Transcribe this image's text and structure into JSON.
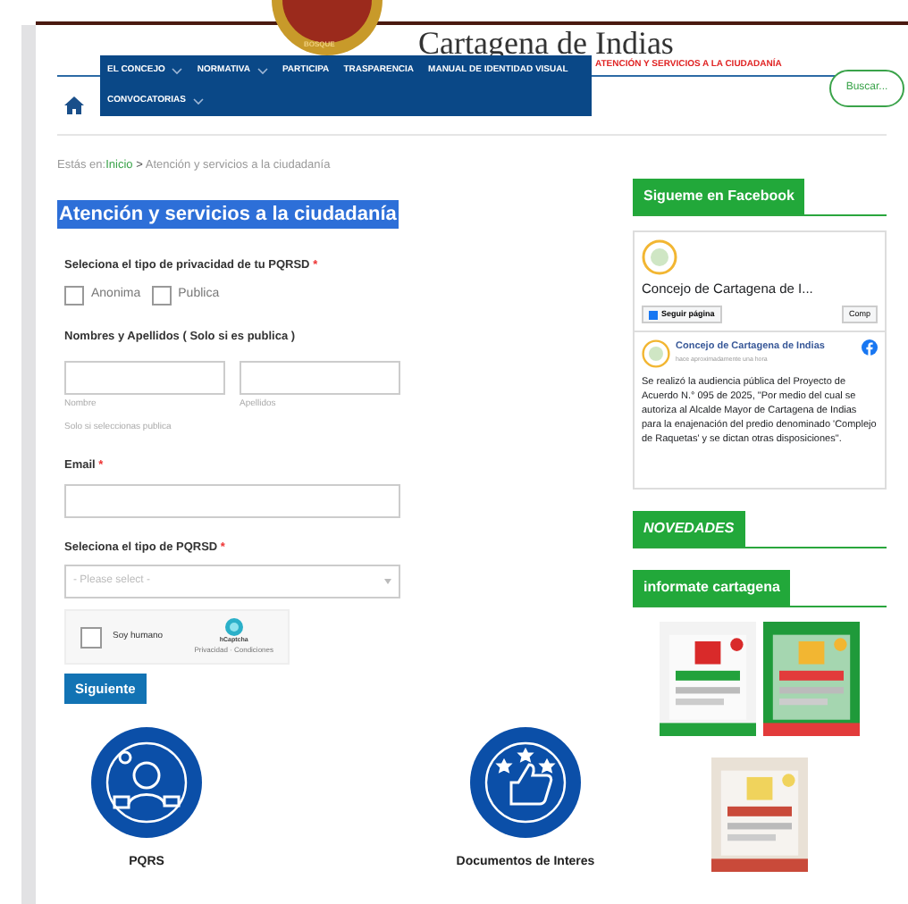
{
  "header": {
    "site_title": "Cartagena de Indias",
    "logo_text": "BOSQUE"
  },
  "nav": {
    "items": [
      {
        "label": "EL CONCEJO",
        "dropdown": true,
        "selected": false
      },
      {
        "label": "NORMATIVA",
        "dropdown": true,
        "selected": false
      },
      {
        "label": "PARTICIPA",
        "dropdown": false,
        "selected": false
      },
      {
        "label": "TRASPARENCIA",
        "dropdown": false,
        "selected": false
      },
      {
        "label": "MANUAL DE IDENTIDAD VISUAL",
        "dropdown": false,
        "selected": false
      },
      {
        "label": "ATENCIÓN Y SERVICIOS A LA CIUDADANÍA",
        "dropdown": false,
        "selected": true
      },
      {
        "label": "CONVOCATORIAS",
        "dropdown": true,
        "selected": false
      }
    ],
    "search_button": "Buscar..."
  },
  "breadcrumb": {
    "prefix": "Estás en:",
    "home": "Inicio",
    "separator": ">",
    "current": "Atención y servicios a la ciudadanía"
  },
  "page_title": "Atención y servicios a la ciudadanía",
  "form": {
    "privacy_label": "Seleciona el tipo de privacidad de tu PQRSD",
    "required_mark": "*",
    "privacy_options": [
      {
        "label": "Anonima",
        "checked": false
      },
      {
        "label": "Publica",
        "checked": false
      }
    ],
    "name_label": "Nombres y Apellidos ( Solo si es publica )",
    "name_fields": [
      "Nombre",
      "Apellidos"
    ],
    "name_help": "Solo si seleccionas publica",
    "email_label": "Email",
    "type_label": "Seleciona el tipo de PQRSD",
    "type_select": {
      "placeholder": "- Please select -"
    },
    "captcha": {
      "label": "Soy humano",
      "checked": false,
      "brand": "hCaptcha",
      "links": "Privacidad · Condiciones"
    },
    "submit": "Siguiente"
  },
  "services": [
    {
      "label": "PQRS",
      "kind": "person"
    },
    {
      "label": "Documentos de Interes",
      "kind": "thumbs"
    }
  ],
  "sidebar": {
    "facebook_heading": "Sigueme en Facebook",
    "facebook": {
      "page_name": "Concejo de Cartagena de I...",
      "follow": "Seguir página",
      "share": "Comp",
      "post_author": "Concejo de Cartagena de Indias",
      "post_time": "hace aproximadamente una hora",
      "post_text": "Se realizó la audiencia pública del Proyecto de Acuerdo N.° 095 de 2025, \"Por medio del cual se autoriza al Alcalde Mayor de Cartagena de Indias para la enajenación del predio denominado 'Complejo de Raquetas' y se dictan otras disposiciones\"."
    },
    "news_heading": "NOVEDADES",
    "info_heading": "informate cartagena"
  }
}
